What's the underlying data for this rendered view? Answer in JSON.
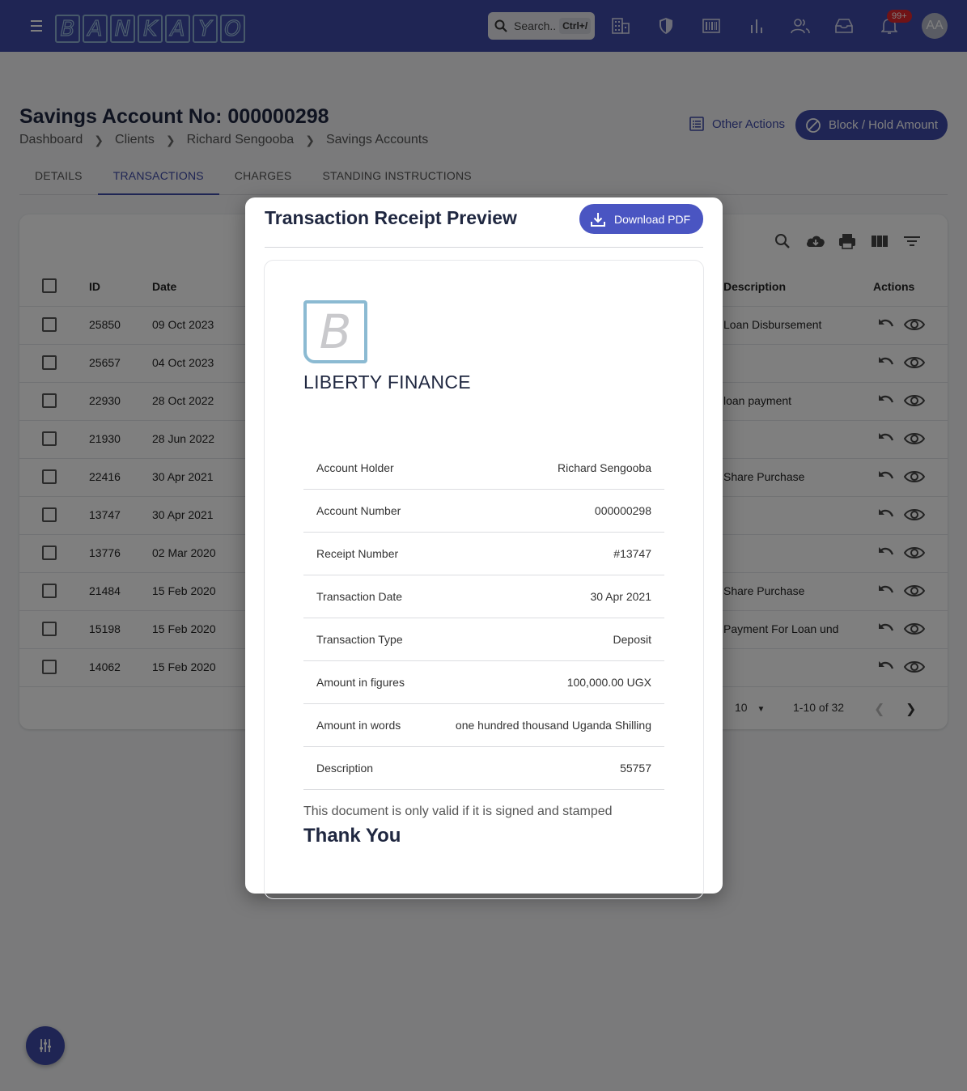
{
  "topbar": {
    "logo_letters": [
      "B",
      "A",
      "N",
      "K",
      "A",
      "Y",
      "O"
    ],
    "search_placeholder": "Search..",
    "search_shortcut": "Ctrl+/",
    "notification_count": "99+",
    "avatar_initials": "AA"
  },
  "page": {
    "title": "Savings Account No: 000000298",
    "breadcrumb": [
      "Dashboard",
      "Clients",
      "Richard Sengooba",
      "Savings Accounts"
    ],
    "other_actions": "Other Actions",
    "block_hold": "Block / Hold Amount"
  },
  "tabs": [
    "DETAILS",
    "TRANSACTIONS",
    "CHARGES",
    "STANDING INSTRUCTIONS"
  ],
  "active_tab": "TRANSACTIONS",
  "table": {
    "headers": {
      "id": "ID",
      "date": "Date",
      "description": "Description",
      "actions": "Actions"
    },
    "rows": [
      {
        "id": "25850",
        "date": "09 Oct 2023",
        "description": "Loan Disbursement"
      },
      {
        "id": "25657",
        "date": "04 Oct 2023",
        "description": ""
      },
      {
        "id": "22930",
        "date": "28 Oct 2022",
        "description": "loan payment"
      },
      {
        "id": "21930",
        "date": "28 Jun 2022",
        "description": ""
      },
      {
        "id": "22416",
        "date": "30 Apr 2021",
        "description": "Share Purchase"
      },
      {
        "id": "13747",
        "date": "30 Apr 2021",
        "description": ""
      },
      {
        "id": "13776",
        "date": "02 Mar 2020",
        "description": ""
      },
      {
        "id": "21484",
        "date": "15 Feb 2020",
        "description": "Share Purchase"
      },
      {
        "id": "15198",
        "date": "15 Feb 2020",
        "description": "Payment For Loan und"
      },
      {
        "id": "14062",
        "date": "15 Feb 2020",
        "description": ""
      }
    ],
    "rows_per_page": "10",
    "range": "1-10 of 32"
  },
  "modal": {
    "title": "Transaction Receipt Preview",
    "download": "Download PDF",
    "logo_letter": "B",
    "company": "LIBERTY FINANCE",
    "fields": [
      {
        "label": "Account Holder",
        "value": "Richard Sengooba"
      },
      {
        "label": "Account Number",
        "value": "000000298"
      },
      {
        "label": "Receipt Number",
        "value": "#13747"
      },
      {
        "label": "Transaction Date",
        "value": "30 Apr 2021"
      },
      {
        "label": "Transaction Type",
        "value": "Deposit"
      },
      {
        "label": "Amount in figures",
        "value": "100,000.00 UGX"
      },
      {
        "label": "Amount in words",
        "value": "one hundred thousand Uganda Shilling"
      },
      {
        "label": "Description",
        "value": "55757"
      }
    ],
    "note": "This document is only valid if it is signed and stamped",
    "thanks": "Thank You"
  },
  "colors": {
    "primary": "#3f4aa8",
    "badge": "#e0262c"
  }
}
